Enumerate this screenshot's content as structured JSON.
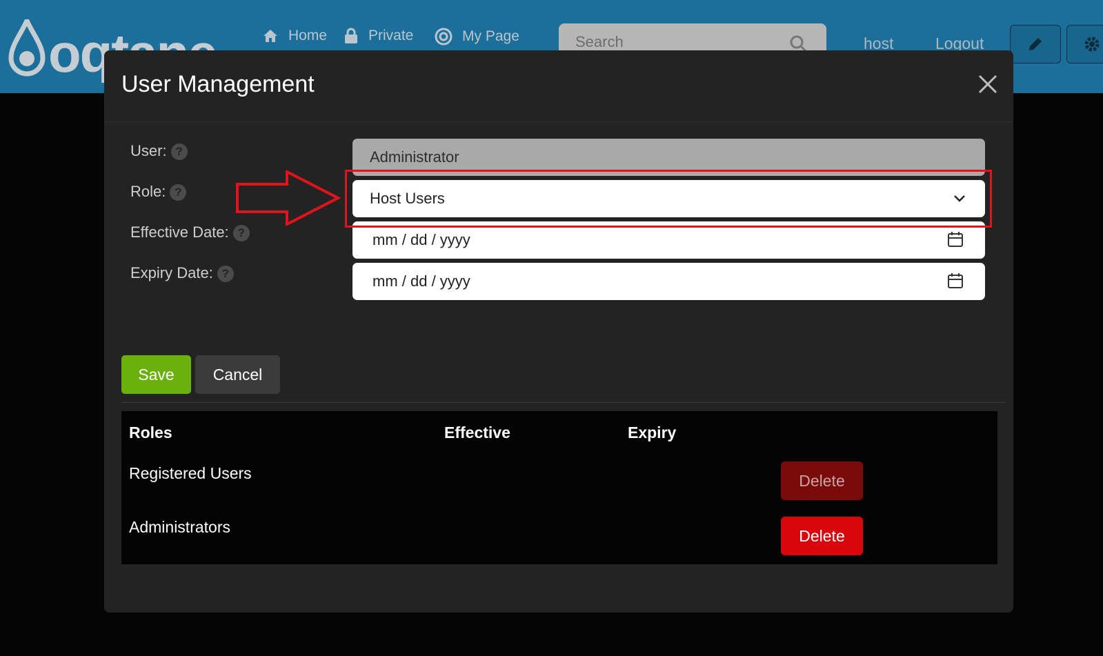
{
  "nav": {
    "brand": "oqtane",
    "home": "Home",
    "private": "Private",
    "mypage": "My Page",
    "search_placeholder": "Search",
    "user": "host",
    "logout": "Logout"
  },
  "modal": {
    "title": "User Management",
    "labels": {
      "user": "User:",
      "role": "Role:",
      "effective": "Effective Date:",
      "expiry": "Expiry Date:"
    },
    "help_glyph": "?",
    "user_value": "Administrator",
    "role_value": "Host Users",
    "effective_value": "mm / dd / yyyy",
    "expiry_value": "mm / dd / yyyy",
    "save": "Save",
    "cancel": "Cancel"
  },
  "table": {
    "headers": [
      "Roles",
      "Effective",
      "Expiry"
    ],
    "rows": [
      {
        "role": "Registered Users",
        "effective": "",
        "expiry": "",
        "action": "Delete",
        "enabled": false
      },
      {
        "role": "Administrators",
        "effective": "",
        "expiry": "",
        "action": "Delete",
        "enabled": true
      }
    ]
  },
  "colors": {
    "topbar": "#1c6f9b",
    "modal": "#232323",
    "save": "#6ab10c",
    "delete": "#d9070c",
    "highlight": "#e1141c"
  }
}
